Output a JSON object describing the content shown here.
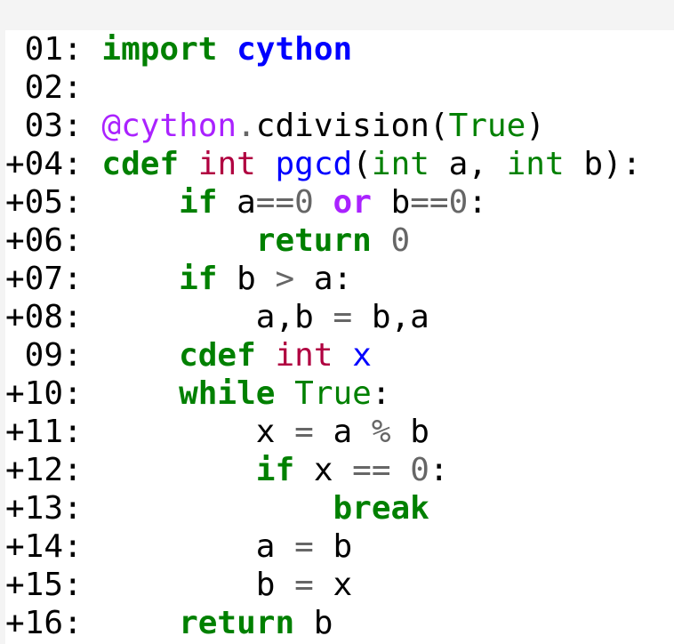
{
  "code": {
    "lines": [
      {
        "num": " 01:",
        "tokens": [
          {
            "t": " "
          },
          {
            "t": "import",
            "c": "kw"
          },
          {
            "t": " "
          },
          {
            "t": "cython",
            "c": "nm",
            "b": true
          }
        ]
      },
      {
        "num": " 02:",
        "tokens": []
      },
      {
        "num": " 03:",
        "tokens": [
          {
            "t": " "
          },
          {
            "t": "@cython",
            "c": "dec"
          },
          {
            "t": ".",
            "c": "op"
          },
          {
            "t": "cdivision",
            "c": "id"
          },
          {
            "t": "(",
            "c": "id"
          },
          {
            "t": "True",
            "c": "bi"
          },
          {
            "t": ")",
            "c": "id"
          }
        ]
      },
      {
        "num": "+04:",
        "tokens": [
          {
            "t": " "
          },
          {
            "t": "cdef",
            "c": "kw"
          },
          {
            "t": " "
          },
          {
            "t": "int",
            "c": "ty"
          },
          {
            "t": " "
          },
          {
            "t": "pgcd",
            "c": "fn"
          },
          {
            "t": "(",
            "c": "id"
          },
          {
            "t": "int",
            "c": "bi"
          },
          {
            "t": " a, "
          },
          {
            "t": "int",
            "c": "bi"
          },
          {
            "t": " b):"
          }
        ]
      },
      {
        "num": "+05:",
        "tokens": [
          {
            "t": "     "
          },
          {
            "t": "if",
            "c": "kw"
          },
          {
            "t": " a"
          },
          {
            "t": "==",
            "c": "op"
          },
          {
            "t": "0",
            "c": "num"
          },
          {
            "t": " "
          },
          {
            "t": "or",
            "c": "kw2"
          },
          {
            "t": " b"
          },
          {
            "t": "==",
            "c": "op"
          },
          {
            "t": "0",
            "c": "num"
          },
          {
            "t": ":"
          }
        ]
      },
      {
        "num": "+06:",
        "tokens": [
          {
            "t": "         "
          },
          {
            "t": "return",
            "c": "kw"
          },
          {
            "t": " "
          },
          {
            "t": "0",
            "c": "num"
          }
        ]
      },
      {
        "num": "+07:",
        "tokens": [
          {
            "t": "     "
          },
          {
            "t": "if",
            "c": "kw"
          },
          {
            "t": " b "
          },
          {
            "t": ">",
            "c": "op"
          },
          {
            "t": " a:"
          }
        ]
      },
      {
        "num": "+08:",
        "tokens": [
          {
            "t": "         a,b "
          },
          {
            "t": "=",
            "c": "op"
          },
          {
            "t": " b,a"
          }
        ]
      },
      {
        "num": " 09:",
        "tokens": [
          {
            "t": "     "
          },
          {
            "t": "cdef",
            "c": "kw"
          },
          {
            "t": " "
          },
          {
            "t": "int",
            "c": "ty"
          },
          {
            "t": " "
          },
          {
            "t": "x",
            "c": "nm"
          }
        ]
      },
      {
        "num": "+10:",
        "tokens": [
          {
            "t": "     "
          },
          {
            "t": "while",
            "c": "kw"
          },
          {
            "t": " "
          },
          {
            "t": "True",
            "c": "bi"
          },
          {
            "t": ":"
          }
        ]
      },
      {
        "num": "+11:",
        "tokens": [
          {
            "t": "         x "
          },
          {
            "t": "=",
            "c": "op"
          },
          {
            "t": " a "
          },
          {
            "t": "%",
            "c": "op"
          },
          {
            "t": " b"
          }
        ]
      },
      {
        "num": "+12:",
        "tokens": [
          {
            "t": "         "
          },
          {
            "t": "if",
            "c": "kw"
          },
          {
            "t": " x "
          },
          {
            "t": "==",
            "c": "op"
          },
          {
            "t": " "
          },
          {
            "t": "0",
            "c": "num"
          },
          {
            "t": ":"
          }
        ]
      },
      {
        "num": "+13:",
        "tokens": [
          {
            "t": "             "
          },
          {
            "t": "break",
            "c": "kw"
          }
        ]
      },
      {
        "num": "+14:",
        "tokens": [
          {
            "t": "         a "
          },
          {
            "t": "=",
            "c": "op"
          },
          {
            "t": " b"
          }
        ]
      },
      {
        "num": "+15:",
        "tokens": [
          {
            "t": "         b "
          },
          {
            "t": "=",
            "c": "op"
          },
          {
            "t": " x"
          }
        ]
      },
      {
        "num": "+16:",
        "tokens": [
          {
            "t": "     "
          },
          {
            "t": "return",
            "c": "kw"
          },
          {
            "t": " b"
          }
        ]
      }
    ]
  }
}
